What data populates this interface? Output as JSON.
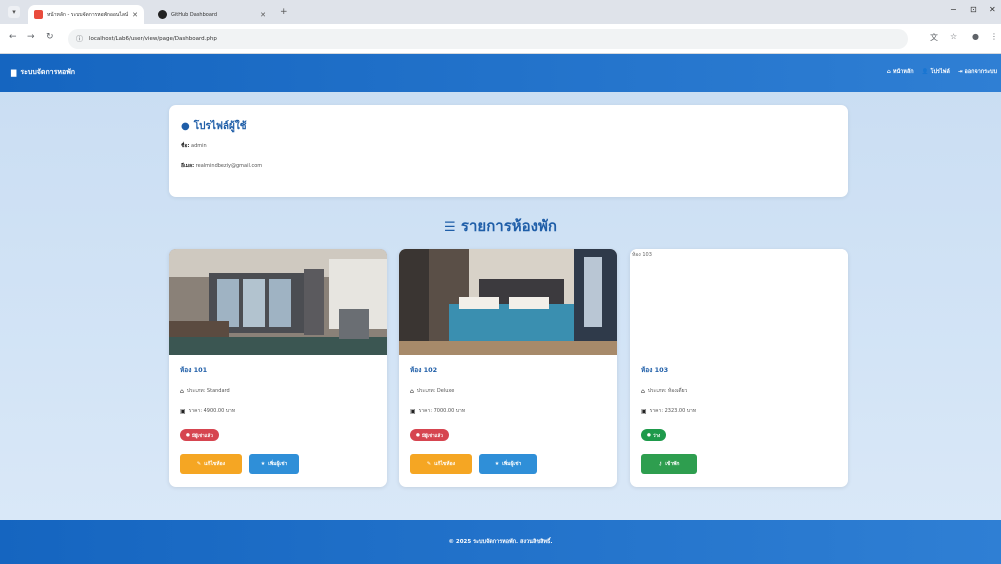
{
  "browser": {
    "tabs": [
      {
        "title": "หน้าหลัก - ระบบจัดการหอพักออนไลน์",
        "active": true
      },
      {
        "title": "GitHub Dashboard",
        "active": false
      }
    ],
    "url": "localhost/Lab6/user/view/page/Dashboard.php",
    "window_controls": [
      "−",
      "⊡",
      "✕"
    ]
  },
  "navbar": {
    "brand": "ระบบจัดการหอพัก",
    "links": [
      {
        "icon": "home-icon",
        "label": "หน้าหลัก"
      },
      {
        "icon": "user-icon",
        "label": "โปรไฟล์"
      },
      {
        "icon": "logout-icon",
        "label": "ออกจากระบบ"
      }
    ]
  },
  "profile": {
    "title": "โปรไฟล์ผู้ใช้",
    "name_label": "ชื่อ:",
    "name_value": "admin",
    "email_label": "อีเมล:",
    "email_value": "realmindbeziy@gmail.com"
  },
  "rooms_title": "รายการห้องพัก",
  "rooms": [
    {
      "name": "ห้อง 101",
      "type_label": "ประเภท: Standard",
      "price_label": "ราคา: 4900.00 บาท",
      "status": "มีผู้เช่าแล้ว",
      "status_kind": "busy",
      "image_alt": "",
      "buttons": [
        {
          "label": "แก้ไขห้อง",
          "kind": "orange"
        },
        {
          "label": "เพิ่มผู้เช่า",
          "kind": "blue"
        }
      ]
    },
    {
      "name": "ห้อง 102",
      "type_label": "ประเภท: Deluxe",
      "price_label": "ราคา: 7000.00 บาท",
      "status": "มีผู้เช่าแล้ว",
      "status_kind": "busy",
      "image_alt": "",
      "buttons": [
        {
          "label": "แก้ไขห้อง",
          "kind": "orange"
        },
        {
          "label": "เพิ่มผู้เช่า",
          "kind": "blue"
        }
      ]
    },
    {
      "name": "ห้อง 103",
      "type_label": "ประเภท: ห้องเดี่ยว",
      "price_label": "ราคา: 2323.00 บาท",
      "status": "ว่าง",
      "status_kind": "free",
      "image_alt": "ห้อง 103",
      "buttons": [
        {
          "label": "เข้าพัก",
          "kind": "green"
        }
      ]
    }
  ],
  "footer": "© 2025 ระบบจัดการหอพัก. สงวนลิขสิทธิ์.",
  "colors": {
    "primary": "#1565c0",
    "title_blue": "#1f5ea8",
    "busy": "#d64550",
    "free": "#1e9a4b",
    "edit": "#f5a623",
    "add": "#2f8fd8"
  }
}
